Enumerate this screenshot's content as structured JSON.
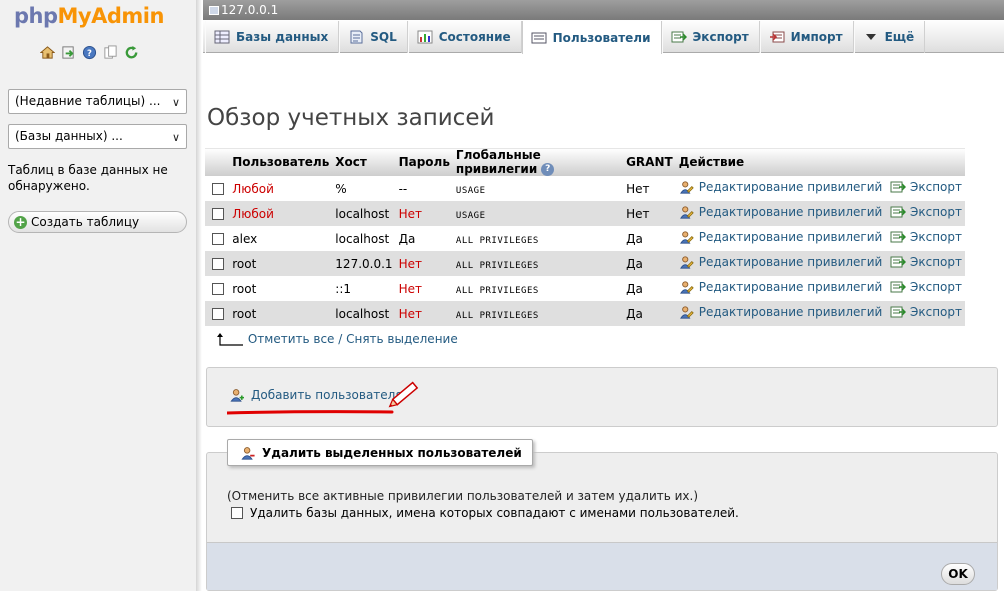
{
  "app": {
    "logo_part1": "php",
    "logo_part2": "MyAdmin"
  },
  "nav": {
    "icons": [
      "home-icon",
      "sql-query-icon",
      "help-icon",
      "docs-icon",
      "reload-icon"
    ],
    "recent_tables": "(Недавние таблицы) ...",
    "databases": "(Базы данных) ...",
    "no_tables_note": "Таблиц в базе данных не обнаружено.",
    "create_table": "Создать таблицу"
  },
  "server": {
    "label": "127.0.0.1"
  },
  "tabs": [
    {
      "label": "Базы данных",
      "icon": "database-icon"
    },
    {
      "label": "SQL",
      "icon": "sql-icon"
    },
    {
      "label": "Состояние",
      "icon": "status-icon"
    },
    {
      "label": "Пользователи",
      "icon": "users-icon",
      "active": true
    },
    {
      "label": "Экспорт",
      "icon": "export-icon"
    },
    {
      "label": "Импорт",
      "icon": "import-icon"
    },
    {
      "label": "Ещё",
      "icon": "more-icon"
    }
  ],
  "page_title": "Обзор учетных записей",
  "table": {
    "headers": [
      "Пользователь",
      "Хост",
      "Пароль",
      "Глобальные привилегии",
      "GRANT",
      "Действие"
    ],
    "rows": [
      {
        "user": "Любой",
        "user_red": true,
        "host": "%",
        "password": "--",
        "password_red": false,
        "privileges": "USAGE",
        "grant": "Нет"
      },
      {
        "user": "Любой",
        "user_red": true,
        "host": "localhost",
        "password": "Нет",
        "password_red": true,
        "privileges": "USAGE",
        "grant": "Нет"
      },
      {
        "user": "alex",
        "user_red": false,
        "host": "localhost",
        "password": "Да",
        "password_red": false,
        "privileges": "ALL PRIVILEGES",
        "grant": "Да"
      },
      {
        "user": "root",
        "user_red": false,
        "host": "127.0.0.1",
        "password": "Нет",
        "password_red": true,
        "privileges": "ALL PRIVILEGES",
        "grant": "Да"
      },
      {
        "user": "root",
        "user_red": false,
        "host": "::1",
        "password": "Нет",
        "password_red": true,
        "privileges": "ALL PRIVILEGES",
        "grant": "Да"
      },
      {
        "user": "root",
        "user_red": false,
        "host": "localhost",
        "password": "Нет",
        "password_red": true,
        "privileges": "ALL PRIVILEGES",
        "grant": "Да"
      }
    ],
    "edit_label": "Редактирование привилегий",
    "export_label": "Экспорт"
  },
  "check_all": {
    "check": "Отметить все",
    "separator": " / ",
    "uncheck": "Снять выделение"
  },
  "add_user": "Добавить пользователя",
  "delete_section": {
    "legend": "Удалить выделенных пользователей",
    "note": "(Отменить все активные привилегии пользователей и затем удалить их.)",
    "drop_db_label": "Удалить базы данных, имена которых совпадают с именами пользователей.",
    "ok": "OK"
  },
  "colors": {
    "link": "#235a81",
    "red": "#cc0000",
    "highlight_mark": "#e00000"
  }
}
